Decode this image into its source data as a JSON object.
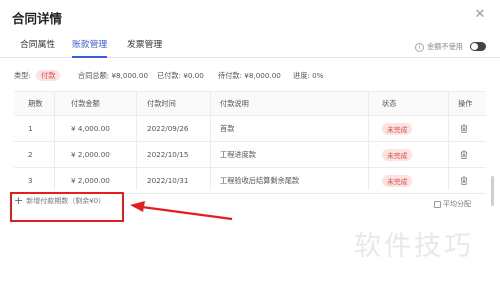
{
  "dialog": {
    "title": "合同详情",
    "close_icon": "close-icon"
  },
  "tabs": [
    {
      "label": "合同属性",
      "active": false
    },
    {
      "label": "账款管理",
      "active": true
    },
    {
      "label": "发票管理",
      "active": false
    }
  ],
  "option": {
    "label": "金额不使用",
    "toggle_on": true
  },
  "summary": {
    "type_label": "类型:",
    "type_value": "付款",
    "total": "合同总额: ¥8,000.00",
    "paid": "已付款: ¥0.00",
    "unpaid": "待付款: ¥8,000.00",
    "progress": "进度: 0%"
  },
  "table": {
    "headers": [
      "期数",
      "付款金额",
      "付款时间",
      "付款说明",
      "状态",
      "操作"
    ],
    "rows": [
      {
        "no": "1",
        "amount": "¥ 4,000.00",
        "date": "2022/09/26",
        "desc": "首款",
        "status": "未完成"
      },
      {
        "no": "2",
        "amount": "¥ 2,000.00",
        "date": "2022/10/15",
        "desc": "工程进度款",
        "status": "未完成"
      },
      {
        "no": "3",
        "amount": "¥ 2,000.00",
        "date": "2022/10/31",
        "desc": "工程验收后结算剩余尾款",
        "status": "未完成"
      }
    ]
  },
  "actions": {
    "add_label": "新增付款期数（剩余¥0）",
    "average_label": "平均分配"
  },
  "watermark": "软件技巧",
  "colors": {
    "accent": "#3b5bdb",
    "status_bg": "#fde2e2",
    "status_text": "#d9534f",
    "highlight": "#e02020"
  }
}
